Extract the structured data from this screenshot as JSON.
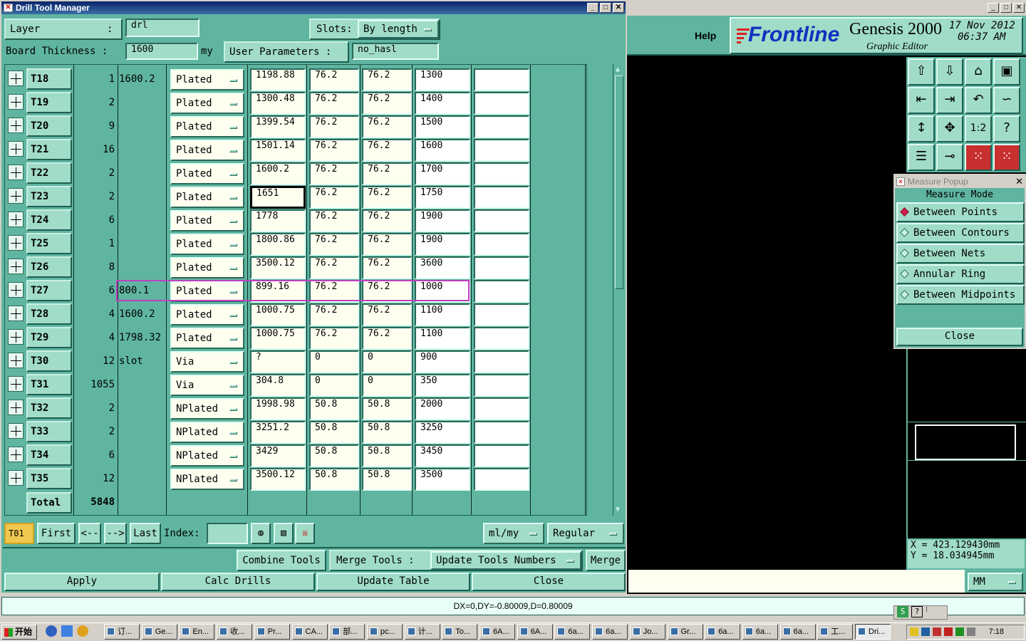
{
  "drill_window": {
    "title": "Drill Tool Manager",
    "layer_label": "Layer",
    "layer_colon": ":",
    "layer_value": "drl",
    "slots_label": "Slots:",
    "slots_value": "By length",
    "board_thickness_label": "Board Thickness :",
    "board_thickness_value": "1600",
    "board_thickness_unit": "my",
    "user_params_label": "User Parameters :",
    "user_params_value": "no_hasl",
    "rows": [
      {
        "tool": "T18",
        "count": "1",
        "info": "1600.2",
        "type": "Plated",
        "d1": "1198.88",
        "d2": "76.2",
        "d3": "76.2",
        "d4": "1300",
        "d5": ""
      },
      {
        "tool": "T19",
        "count": "2",
        "info": "",
        "type": "Plated",
        "d1": "1300.48",
        "d2": "76.2",
        "d3": "76.2",
        "d4": "1400",
        "d5": ""
      },
      {
        "tool": "T20",
        "count": "9",
        "info": "",
        "type": "Plated",
        "d1": "1399.54",
        "d2": "76.2",
        "d3": "76.2",
        "d4": "1500",
        "d5": ""
      },
      {
        "tool": "T21",
        "count": "16",
        "info": "",
        "type": "Plated",
        "d1": "1501.14",
        "d2": "76.2",
        "d3": "76.2",
        "d4": "1600",
        "d5": ""
      },
      {
        "tool": "T22",
        "count": "2",
        "info": "",
        "type": "Plated",
        "d1": "1600.2",
        "d2": "76.2",
        "d3": "76.2",
        "d4": "1700",
        "d5": ""
      },
      {
        "tool": "T23",
        "count": "2",
        "info": "",
        "type": "Plated",
        "d1": "1651",
        "d2": "76.2",
        "d3": "76.2",
        "d4": "1750",
        "d5": ""
      },
      {
        "tool": "T24",
        "count": "6",
        "info": "",
        "type": "Plated",
        "d1": "1778",
        "d2": "76.2",
        "d3": "76.2",
        "d4": "1900",
        "d5": ""
      },
      {
        "tool": "T25",
        "count": "1",
        "info": "",
        "type": "Plated",
        "d1": "1800.86",
        "d2": "76.2",
        "d3": "76.2",
        "d4": "1900",
        "d5": ""
      },
      {
        "tool": "T26",
        "count": "8",
        "info": "",
        "type": "Plated",
        "d1": "3500.12",
        "d2": "76.2",
        "d3": "76.2",
        "d4": "3600",
        "d5": ""
      },
      {
        "tool": "T27",
        "count": "6",
        "info": "800.1",
        "type": "Plated",
        "d1": "899.16",
        "d2": "76.2",
        "d3": "76.2",
        "d4": "1000",
        "d5": ""
      },
      {
        "tool": "T28",
        "count": "4",
        "info": "1600.2",
        "type": "Plated",
        "d1": "1000.75",
        "d2": "76.2",
        "d3": "76.2",
        "d4": "1100",
        "d5": ""
      },
      {
        "tool": "T29",
        "count": "4",
        "info": "1798.32",
        "type": "Plated",
        "d1": "1000.75",
        "d2": "76.2",
        "d3": "76.2",
        "d4": "1100",
        "d5": ""
      },
      {
        "tool": "T30",
        "count": "12",
        "info": "slot",
        "type": "Via",
        "d1": "?",
        "d2": "0",
        "d3": "0",
        "d4": "900",
        "d5": ""
      },
      {
        "tool": "T31",
        "count": "1055",
        "info": "",
        "type": "Via",
        "d1": "304.8",
        "d2": "0",
        "d3": "0",
        "d4": "350",
        "d5": ""
      },
      {
        "tool": "T32",
        "count": "2",
        "info": "",
        "type": "NPlated",
        "d1": "1998.98",
        "d2": "50.8",
        "d3": "50.8",
        "d4": "2000",
        "d5": ""
      },
      {
        "tool": "T33",
        "count": "2",
        "info": "",
        "type": "NPlated",
        "d1": "3251.2",
        "d2": "50.8",
        "d3": "50.8",
        "d4": "3250",
        "d5": ""
      },
      {
        "tool": "T34",
        "count": "6",
        "info": "",
        "type": "NPlated",
        "d1": "3429",
        "d2": "50.8",
        "d3": "50.8",
        "d4": "3450",
        "d5": ""
      },
      {
        "tool": "T35",
        "count": "12",
        "info": "",
        "type": "NPlated",
        "d1": "3500.12",
        "d2": "50.8",
        "d3": "50.8",
        "d4": "3500",
        "d5": ""
      }
    ],
    "total_label": "Total",
    "total_value": "5848",
    "nav": {
      "current_tool": "T01",
      "first": "First",
      "prev": "<--",
      "next": "-->",
      "last": "Last",
      "index_label": "Index:",
      "index_value": "",
      "units": "ml/my",
      "mode": "Regular"
    },
    "combine_tools": "Combine Tools",
    "merge_tools_label": "Merge Tools :",
    "merge_tools_value": "Update Tools Numbers",
    "merge": "Merge",
    "apply": "Apply",
    "calc_drills": "Calc Drills",
    "update_table": "Update Table",
    "close": "Close"
  },
  "genesis": {
    "help": "Help",
    "brand": "Frontline",
    "product": "Genesis 2000",
    "subtitle": "Graphic Editor",
    "date": "17 Nov 2012",
    "time": "06:37 AM",
    "coord_x": "X = 423.129430mm",
    "coord_y": "Y = 18.034945mm",
    "units": "MM",
    "toolbar_icons": [
      "home-up-icon",
      "home-down-icon",
      "home-icon",
      "window-icon",
      "pan-left-icon",
      "pan-right-icon",
      "zoom-back-icon",
      "redraw-icon",
      "fit-vertical-icon",
      "fit-all-icon",
      "one-to-one-icon",
      "help-icon",
      "settings-icon",
      "measure-icon",
      "snap-grid-icon",
      "snap-grid-red-icon"
    ],
    "toolbar_glyphs": [
      "⇧",
      "⇩",
      "⌂",
      "▣",
      "⇤",
      "⇥",
      "↶",
      "∽",
      "↕",
      "✥",
      "1:2",
      "?",
      "☰",
      "⊸",
      "⁙",
      "⁙"
    ]
  },
  "measure_popup": {
    "title": "Measure Popup",
    "header": "Measure Mode",
    "options": [
      "Between Points",
      "Between Contours",
      "Between Nets",
      "Annular Ring",
      "Between Midpoints"
    ],
    "selected_index": 0,
    "close": "Close"
  },
  "status_bar": {
    "text": "DX=0,DY=-0.80009,D=0.80009"
  },
  "taskbar": {
    "start": "开始",
    "clock": "7:18",
    "items": [
      "订...",
      "Ge...",
      "En...",
      "收...",
      "Pr...",
      "CA...",
      "部...",
      "pc...",
      "计...",
      "To...",
      "6A...",
      "6A...",
      "6a...",
      "6a...",
      "Jo...",
      "Gr...",
      "6a...",
      "6a...",
      "6a...",
      "工...",
      "Dri..."
    ]
  }
}
